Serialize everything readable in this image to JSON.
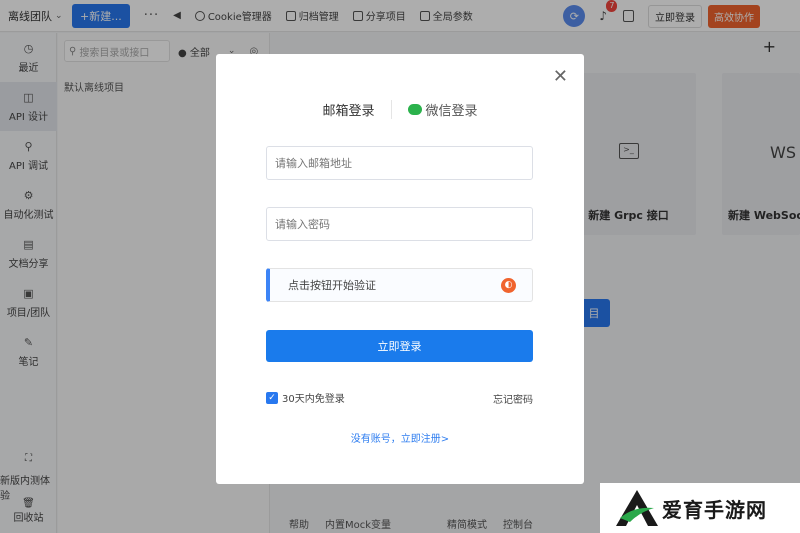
{
  "topbar": {
    "team": "离线团队",
    "new_button": "+新建...",
    "more": "···",
    "back": "◀",
    "tools": [
      "Cookie管理器",
      "归档管理",
      "分享项目",
      "全局参数"
    ],
    "notification_count": "7",
    "login": "立即登录",
    "collab": "高效协作"
  },
  "sidebar": {
    "items": [
      {
        "label": "最近",
        "icon": "clock-icon",
        "glyph": "◷"
      },
      {
        "label": "API 设计",
        "icon": "design-icon",
        "glyph": "◫"
      },
      {
        "label": "API 调试",
        "icon": "debug-icon",
        "glyph": "⚲"
      },
      {
        "label": "自动化测试",
        "icon": "automation-icon",
        "glyph": "⚙"
      },
      {
        "label": "文档分享",
        "icon": "doc-share-icon",
        "glyph": "▤"
      },
      {
        "label": "项目/团队",
        "icon": "project-icon",
        "glyph": "▣"
      },
      {
        "label": "笔记",
        "icon": "note-icon",
        "glyph": "✎"
      }
    ],
    "beta": "新版内测体验",
    "trash": "回收站"
  },
  "panel": {
    "search_placeholder": "搜索目录或接口",
    "filter": "● 全部",
    "project": "默认离线项目"
  },
  "main": {
    "card_grpc": "新建 Grpc 接口",
    "card_ws": "新建 WebSock",
    "ws_glyph": "WS",
    "button_partial": "目",
    "footer": [
      "帮助",
      "内置Mock变量",
      "精简模式",
      "控制台"
    ]
  },
  "modal": {
    "tab_email": "邮箱登录",
    "tab_wechat": "微信登录",
    "email_placeholder": "请输入邮箱地址",
    "password_placeholder": "请输入密码",
    "verify": "点击按钮开始验证",
    "submit": "立即登录",
    "remember": "30天内免登录",
    "forgot": "忘记密码",
    "register": "没有账号，立即注册>"
  },
  "watermark": {
    "text": "爱育手游网"
  }
}
